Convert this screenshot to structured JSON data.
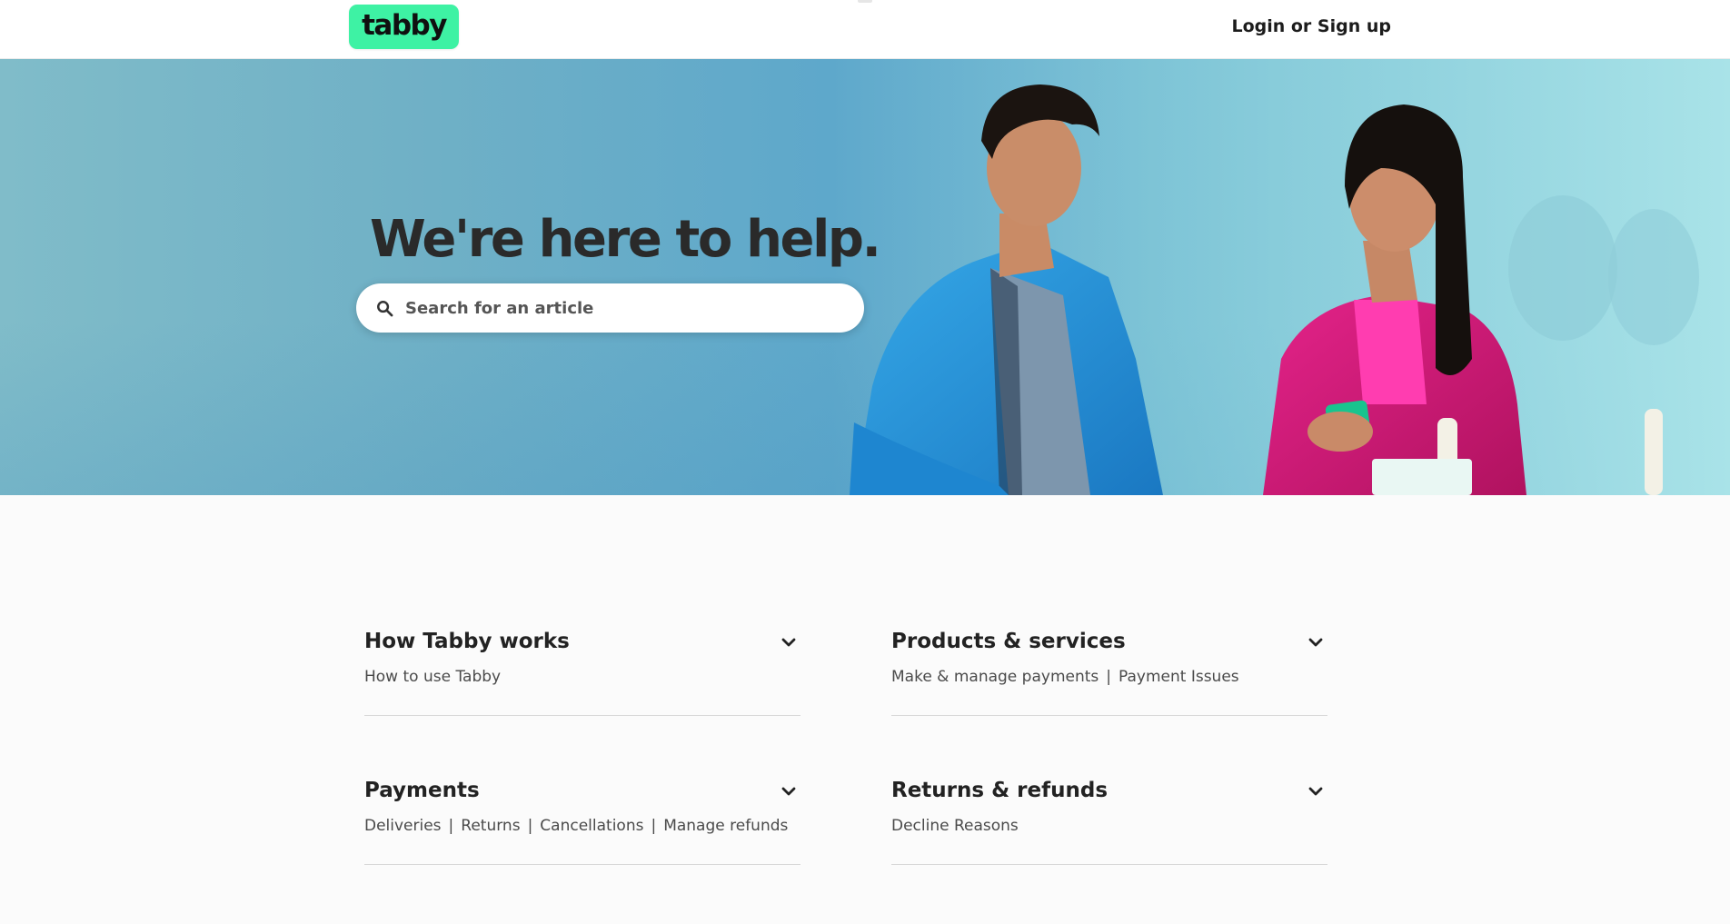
{
  "header": {
    "logo_text": "tabby",
    "login_label": "Login or Sign up"
  },
  "hero": {
    "title": "We're here to help.",
    "search": {
      "placeholder": "Search for an article",
      "value": ""
    }
  },
  "categories": [
    {
      "title": "How Tabby works",
      "links": [
        "How to use Tabby"
      ]
    },
    {
      "title": "Products & services",
      "links": [
        "Make & manage payments",
        "Payment Issues"
      ]
    },
    {
      "title": "Payments",
      "links": [
        "Deliveries",
        "Returns",
        "Cancellations",
        "Manage refunds"
      ]
    },
    {
      "title": "Returns & refunds",
      "links": [
        "Decline Reasons"
      ]
    }
  ],
  "colors": {
    "brand": "#3ef2a4",
    "text": "#1f1f1f",
    "hero_bg": "#5ea8cb"
  },
  "icons": {
    "search": "search-icon",
    "chevron": "chevron-down-icon"
  }
}
